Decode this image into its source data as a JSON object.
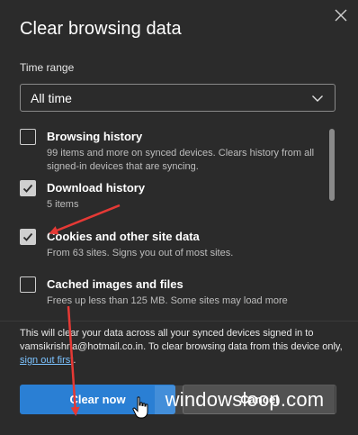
{
  "dialog": {
    "title": "Clear browsing data",
    "close_icon": "close-icon"
  },
  "time_range": {
    "label": "Time range",
    "selected": "All time",
    "icon": "chevron-down-icon"
  },
  "options": [
    {
      "title": "Browsing history",
      "desc": "99 items and more on synced devices. Clears history from all signed-in devices that are syncing.",
      "checked": false
    },
    {
      "title": "Download history",
      "desc": "5 items",
      "checked": true
    },
    {
      "title": "Cookies and other site data",
      "desc": "From 63 sites. Signs you out of most sites.",
      "checked": true
    },
    {
      "title": "Cached images and files",
      "desc": "Frees up less than 125 MB. Some sites may load more",
      "checked": false
    }
  ],
  "notice": {
    "text_before": "This will clear your data across all your synced devices signed in to vamsikrishna@hotmail.co.in. To clear browsing data from this device only, ",
    "link": "sign out first",
    "text_after": "."
  },
  "buttons": {
    "clear_now": "Clear now",
    "cancel": "Cancel"
  },
  "watermark": "windowsloop.com",
  "colors": {
    "background": "#2b2b2b",
    "primary": "#2a7fd4",
    "link": "#7cc3ff",
    "annotation_arrow": "#e53935"
  }
}
